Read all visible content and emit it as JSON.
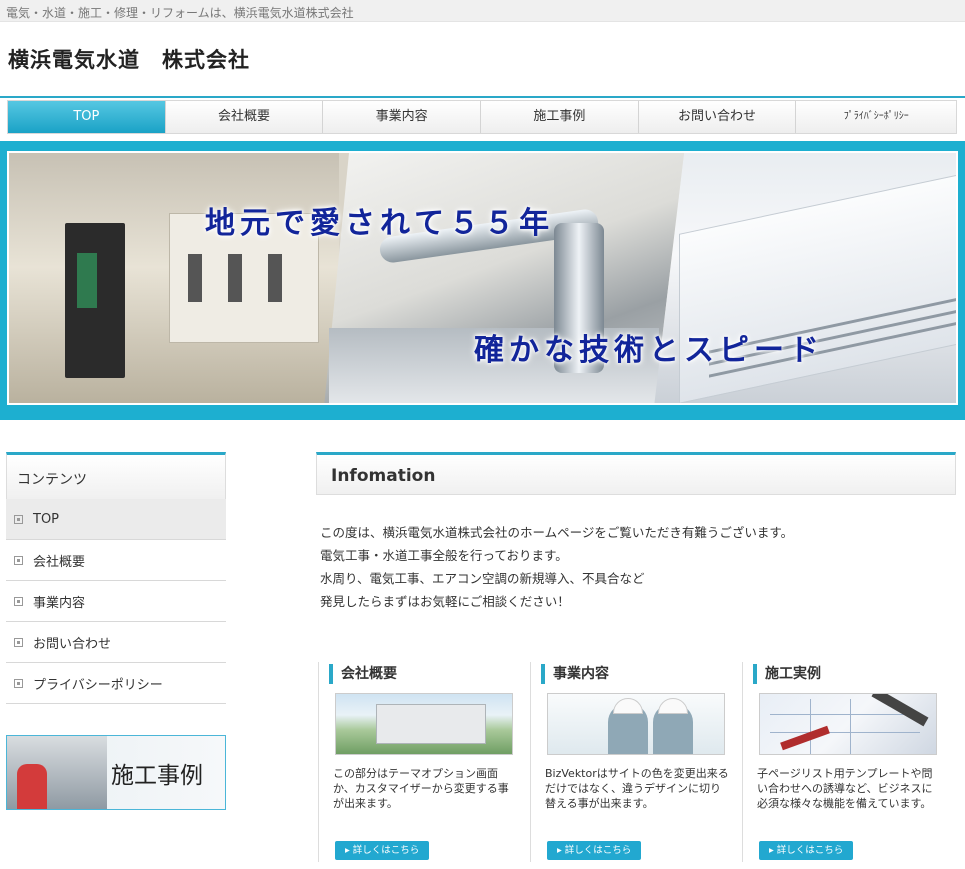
{
  "topbar": {
    "text": "電気・水道・施工・修理・リフォームは、横浜電気水道株式会社"
  },
  "site": {
    "name": "横浜電気水道　株式会社"
  },
  "gnav": {
    "items": [
      {
        "label": "TOP"
      },
      {
        "label": "会社概要"
      },
      {
        "label": "事業内容"
      },
      {
        "label": "施工事例"
      },
      {
        "label": "お問い合わせ"
      },
      {
        "label": "ﾌﾟﾗｲﾊﾞｼｰﾎﾟﾘｼｰ"
      }
    ]
  },
  "hero": {
    "line1": "地元で愛されて５５年",
    "line2": "確かな技術とスピード"
  },
  "sidebar": {
    "title": "コンテンツ",
    "items": [
      {
        "label": "TOP"
      },
      {
        "label": "会社概要"
      },
      {
        "label": "事業内容"
      },
      {
        "label": "お問い合わせ"
      },
      {
        "label": "プライバシーポリシー"
      }
    ],
    "banner": "施工事例"
  },
  "info": {
    "title": "Infomation",
    "lines": [
      "この度は、横浜電気水道株式会社のホームページをご覧いただき有難うございます。",
      "電気工事・水道工事全般を行っております。",
      "水周り、電気工事、エアコン空調の新規導入、不具合など",
      "発見したらまずはお気軽にご相談ください！"
    ]
  },
  "columns": [
    {
      "title": "会社概要",
      "text": "この部分はテーマオプション画面か、カスタマイザーから変更する事が出来ます。",
      "button": "詳しくはこちら"
    },
    {
      "title": "事業内容",
      "text": "BizVektorはサイトの色を変更出来るだけではなく、違うデザインに切り替える事が出来ます。",
      "button": "詳しくはこちら"
    },
    {
      "title": "施工実例",
      "text": "子ページリスト用テンプレートや問い合わせへの誘導など、ビジネスに必須な様々な機能を備えています。",
      "button": "詳しくはこちら"
    }
  ],
  "colors": {
    "accent": "#2aa8c8",
    "nav_active": "#1aa2c6",
    "hero_text": "#12259a",
    "hero_frame": "#1dafd0"
  }
}
